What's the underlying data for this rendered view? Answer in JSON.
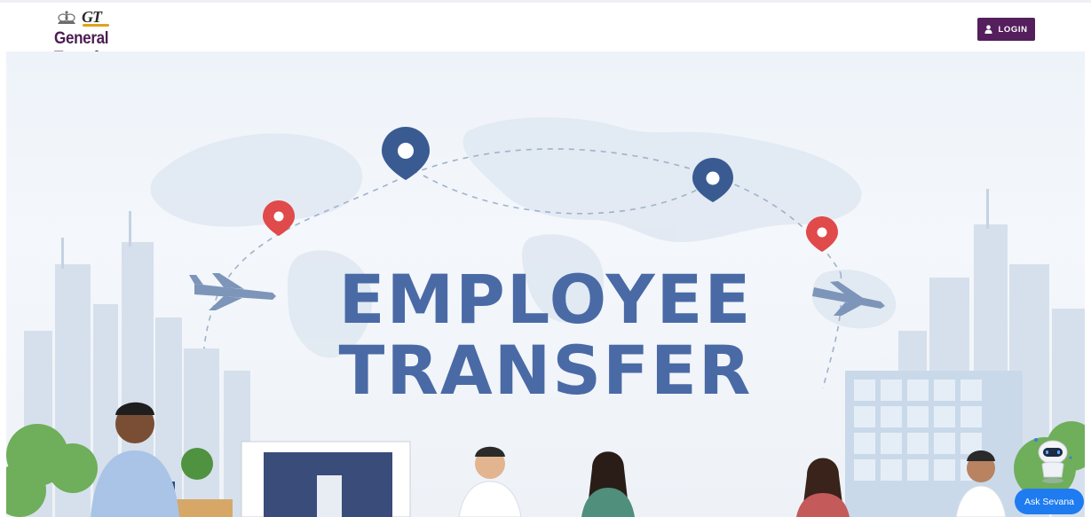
{
  "header": {
    "logo_mark": "GT",
    "logo_title": "General Transfer",
    "login_label": "LOGIN"
  },
  "hero": {
    "title_line1": "EMPLOYEE",
    "title_line2": "TRANSFER"
  },
  "chat": {
    "button_label": "Ask Sevana"
  },
  "colors": {
    "brand_purple": "#541f5c",
    "title_blue": "#4a6aa6",
    "chat_blue": "#1f7bf0",
    "pin_navy": "#3a5b92",
    "pin_red": "#e04a4a"
  },
  "icons": [
    "emblem-icon",
    "user-icon",
    "map-pin-icon",
    "airplane-icon",
    "chatbot-icon"
  ]
}
